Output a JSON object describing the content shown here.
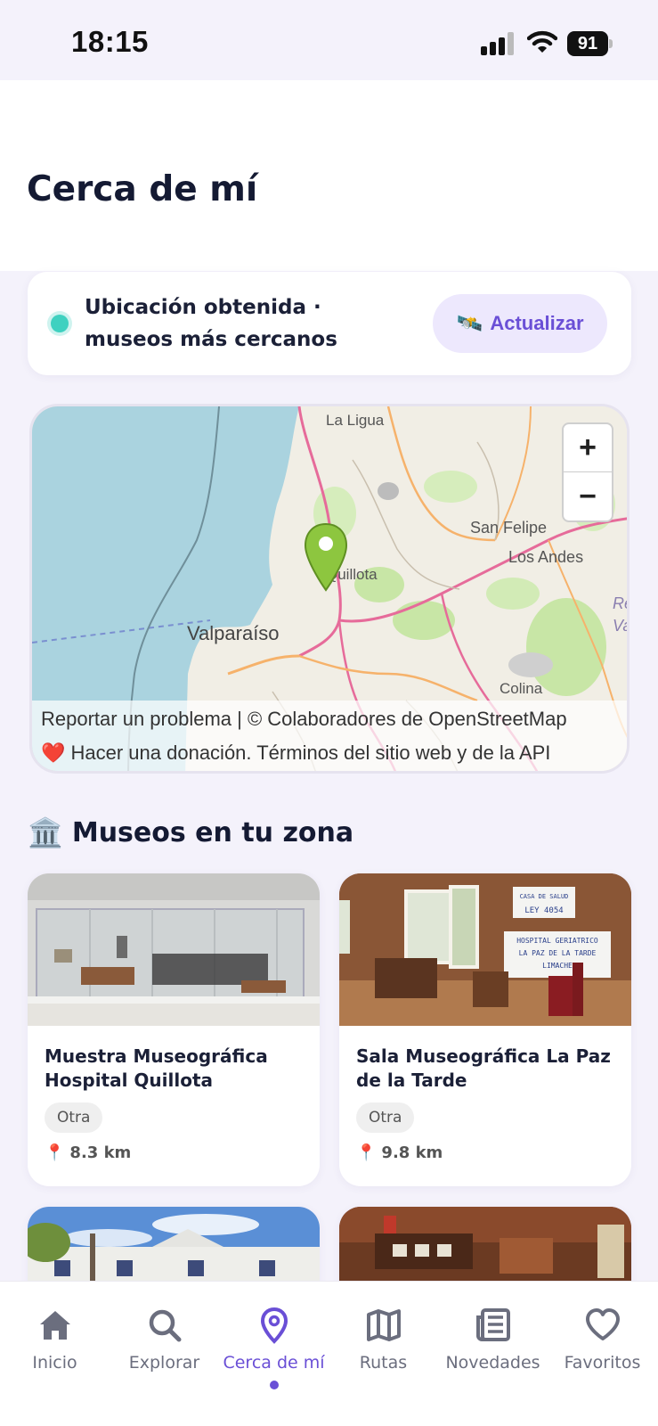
{
  "status_bar": {
    "time": "18:15",
    "battery": "91"
  },
  "header": {
    "title": "Cerca de mí"
  },
  "location": {
    "status": "Ubicación obtenida · museos más cercanos",
    "refresh_icon": "🛰️",
    "refresh_label": "Actualizar"
  },
  "map": {
    "places": {
      "la_ligua": "La Ligua",
      "san_felipe": "San Felipe",
      "los_andes": "Los Andes",
      "quillota": "Quillota",
      "valparaiso": "Valparaíso",
      "colina": "Colina",
      "edge_1": "Re",
      "edge_2": "Va"
    },
    "zoom_in": "+",
    "zoom_out": "−",
    "attribution_line1": "Reportar un problema | © Colaboradores de OpenStreetMap",
    "attribution_line2": "❤️ Hacer una donación. Términos del sitio web y de la API"
  },
  "section": {
    "icon": "🏛️",
    "title": "Museos en tu zona"
  },
  "museums": [
    {
      "name": "Muestra Museográfica Hospital Quillota",
      "tag": "Otra",
      "pin_icon": "📍",
      "distance": "8.3 km"
    },
    {
      "name": "Sala Museográfica La Paz de la Tarde",
      "tag": "Otra",
      "pin_icon": "📍",
      "distance": "9.8 km"
    }
  ],
  "sign_text": {
    "l1": "CASA DE SALUD",
    "l2": "LEY 4054",
    "l3": "HOSPITAL GERIATRICO",
    "l4": "LA PAZ DE LA TARDE",
    "l5": "LIMACHE"
  },
  "nav": [
    {
      "label": "Inicio",
      "icon": "home-icon"
    },
    {
      "label": "Explorar",
      "icon": "search-icon"
    },
    {
      "label": "Cerca de mí",
      "icon": "location-pin-icon"
    },
    {
      "label": "Rutas",
      "icon": "map-icon"
    },
    {
      "label": "Novedades",
      "icon": "newspaper-icon"
    },
    {
      "label": "Favoritos",
      "icon": "heart-icon"
    }
  ],
  "colors": {
    "accent": "#6a4fd6",
    "accent_bg": "#ede8fd",
    "status_dot": "#3fd1c0",
    "nav_inactive": "#6b6e7e"
  }
}
